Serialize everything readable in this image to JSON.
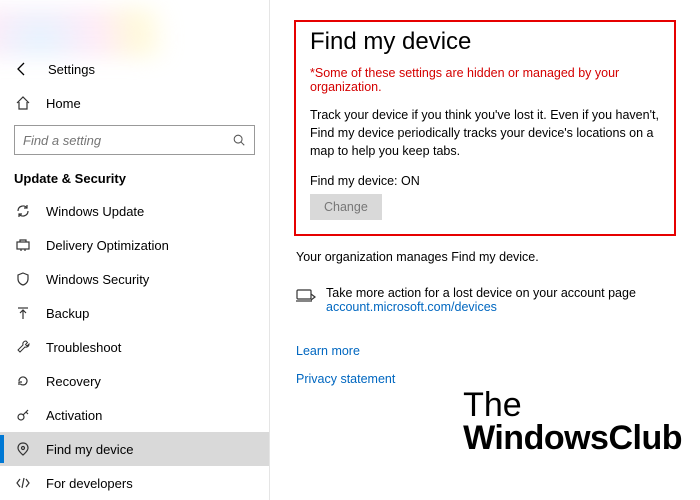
{
  "header": {
    "settings_label": "Settings"
  },
  "sidebar": {
    "home_label": "Home",
    "search_placeholder": "Find a setting",
    "category_label": "Update & Security",
    "items": [
      {
        "label": "Windows Update"
      },
      {
        "label": "Delivery Optimization"
      },
      {
        "label": "Windows Security"
      },
      {
        "label": "Backup"
      },
      {
        "label": "Troubleshoot"
      },
      {
        "label": "Recovery"
      },
      {
        "label": "Activation"
      },
      {
        "label": "Find my device"
      },
      {
        "label": "For developers"
      }
    ]
  },
  "main": {
    "title": "Find my device",
    "warning": "*Some of these settings are hidden or managed by your organization.",
    "description": "Track your device if you think you've lost it. Even if you haven't, Find my device periodically tracks your device's locations on a map to help you keep tabs.",
    "status_label": "Find my device: ON",
    "change_button": "Change",
    "org_manages": "Your organization manages Find my device.",
    "more_action_text": "Take more action for a lost device on your account page",
    "more_action_link": "account.microsoft.com/devices",
    "learn_more": "Learn more",
    "privacy": "Privacy statement"
  },
  "watermark": {
    "line1": "The",
    "line2": "WindowsClub"
  }
}
